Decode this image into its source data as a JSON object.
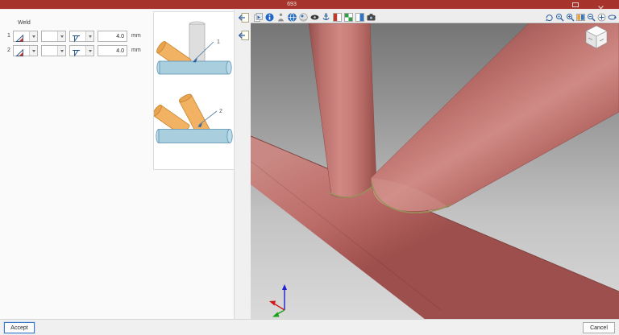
{
  "window": {
    "title": "693"
  },
  "weld": {
    "group_label": "Weld",
    "unit": "mm",
    "rows": [
      {
        "number": "1",
        "size": "4.0"
      },
      {
        "number": "2",
        "size": "4.0"
      }
    ]
  },
  "illustrations": {
    "label_1": "1",
    "label_2": "2"
  },
  "buttons": {
    "accept": "Accept",
    "cancel": "Cancel"
  },
  "icons": {
    "window_controls": [
      "maximize",
      "close"
    ],
    "side_strip": [
      "dock-arrow",
      "dock-arrow"
    ],
    "weld_row_dropdowns": [
      "weld-type-triangle",
      "empty",
      "weld-symbol-fillet"
    ],
    "view_toolbar": [
      "copy-picture",
      "info",
      "walk",
      "workplane-globe",
      "reference-sphere",
      "visibility-eye",
      "anchor",
      "view-red",
      "view-checker-green",
      "view-split-blue",
      "camera"
    ],
    "view_tools": [
      "rotate",
      "zoom-original",
      "zoom-in",
      "fit-work-area",
      "zoom-out",
      "pan-hand",
      "orbit"
    ],
    "viewport_overlays": [
      "view-cube",
      "axis-triad"
    ]
  },
  "colors": {
    "titlebar": "#a6342c",
    "tube": "#c47a76",
    "tube_dark": "#9c4f4c",
    "weld_line": "#99915a",
    "illustration_chord_blue": "#a9cfdf",
    "illustration_brace_orange": "#f2b263",
    "accent_blue": "#3b78c3"
  }
}
